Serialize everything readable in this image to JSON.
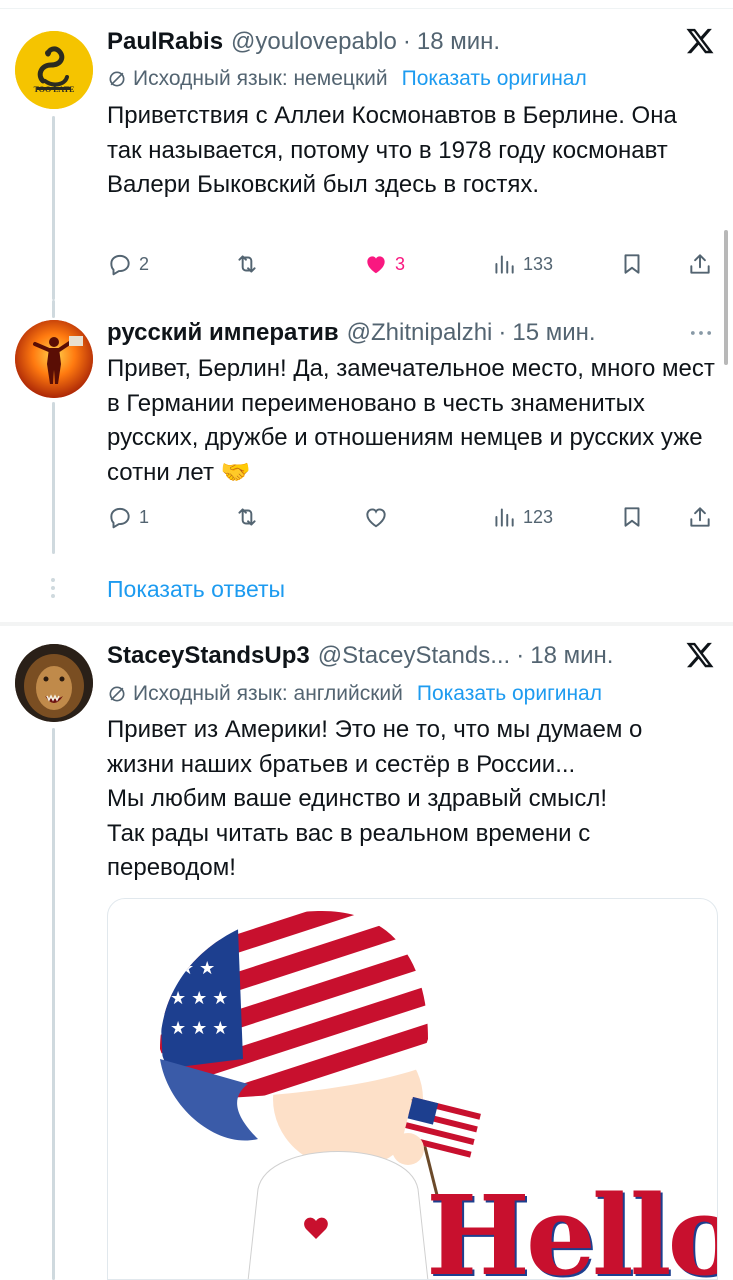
{
  "tweets": [
    {
      "name": "PaulRabis",
      "handle": "@youlovepablo",
      "dot": "·",
      "time": "18 мин.",
      "avatar_text": "TOO LATE",
      "lang_note": "Исходный язык: немецкий",
      "lang_link": "Показать оригинал",
      "text": "Приветствия с Аллеи Космонавтов в Берлине. Она так называется, потому что в 1978 году космонавт Валери Быковский был здесь в гостях.",
      "replies": "2",
      "likes": "3",
      "views": "133",
      "liked": true
    },
    {
      "name": "русский императив",
      "handle": "@Zhitnipalzhi",
      "dot": "·",
      "time": "15 мин.",
      "text": "Привет, Берлин! Да, замечательное место, много мест в Германии переименовано в честь знаменитых русских, дружбе и отношениям немцев и русских уже сотни лет 🤝",
      "replies": "1",
      "views": "123",
      "liked": false
    },
    {
      "name": "StaceyStandsUp3",
      "handle": "@StaceyStands...",
      "dot": "·",
      "time": "18 мин.",
      "lang_note": "Исходный язык: английский",
      "lang_link": "Показать оригинал",
      "text_lines": [
        "Привет из Америки! Это не то, что мы думаем о",
        "жизни наших братьев и сестёр в России...",
        "Мы любим ваше единство и здравый смысл!",
        "Так рады читать вас в реальном времени с",
        "переводом!"
      ],
      "media_text": "Hello"
    }
  ],
  "show_replies": "Показать ответы",
  "colors": {
    "accent": "#1d9bf0",
    "like": "#f91880",
    "muted": "#536471",
    "text": "#0f1419"
  },
  "icons": [
    "x-logo-icon",
    "translate-icon",
    "reply-icon",
    "retweet-icon",
    "heart-icon",
    "views-icon",
    "bookmark-icon",
    "share-icon",
    "more-icon"
  ]
}
